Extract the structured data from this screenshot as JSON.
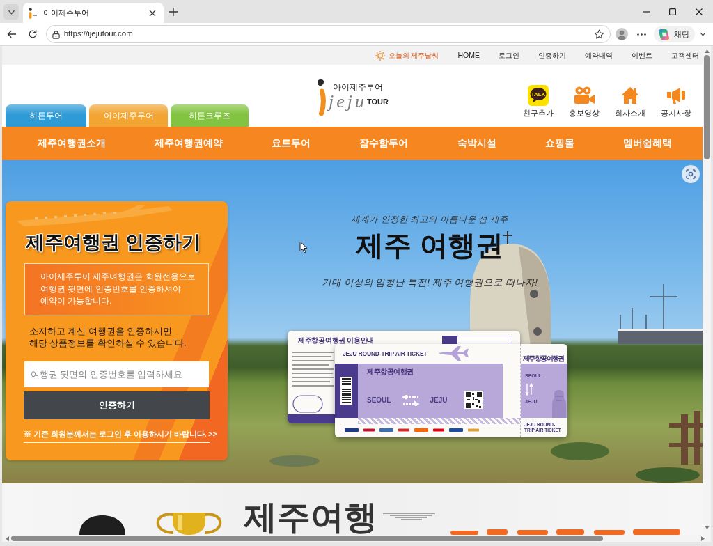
{
  "browser": {
    "tab_title": "아이제주투어",
    "url": "https://ijejutour.com",
    "chat_label": "채팅"
  },
  "top_links": [
    {
      "label": "오늘의 제주날씨",
      "kind": "weather"
    },
    {
      "label": "HOME",
      "kind": "link"
    },
    {
      "label": "로그인",
      "kind": "link"
    },
    {
      "label": "인증하기",
      "kind": "link"
    },
    {
      "label": "예약내역",
      "kind": "link"
    },
    {
      "label": "이벤트",
      "kind": "link"
    },
    {
      "label": "고객센터",
      "kind": "link"
    }
  ],
  "logo": {
    "caption": "아이제주투어",
    "wordmark": "jeju",
    "suffix": "TOUR"
  },
  "site_tabs": [
    {
      "label": "히든투어",
      "color": "#2e9ad6"
    },
    {
      "label": "아이제주투어",
      "color": "#f2a533"
    },
    {
      "label": "히든크루즈",
      "color": "#82c341"
    }
  ],
  "quick_links": [
    {
      "label": "친구추가",
      "kind": "talk",
      "icon_text": "TALK"
    },
    {
      "label": "홍보영상",
      "kind": "video"
    },
    {
      "label": "회사소개",
      "kind": "home"
    },
    {
      "label": "공지사항",
      "kind": "notice"
    }
  ],
  "main_nav": [
    "제주여행권소개",
    "제주여행권예약",
    "요트투어",
    "잠수함투어",
    "숙박시설",
    "쇼핑몰",
    "멤버쉽혜택"
  ],
  "voucher_card": {
    "title": "제주여행권 인증하기",
    "notice": "아이제주투어 제주여행권은 회원전용으로\n여행권 뒷면에 인증번호를 인증하셔야\n예약이 가능합니다.",
    "description": "소지하고 계신 여행권을 인증하시면\n해당 상품정보를 확인하실 수 있습니다.",
    "input": {
      "placeholder": "여행권 뒷면의 인증번호를 입력하세요"
    },
    "button": "인증하기",
    "member_link": "※ 기존 회원분께서는 로그인 후 이용하시기 바랍니다. >>"
  },
  "hero": {
    "kicker": "세계가 인정한 최고의 아름다운 섬 제주",
    "headline": "제주 여행권",
    "tagline": "기대 이상의 엄청난 특전! 제주 여행권으로 떠나자!"
  },
  "tickets": {
    "guide_title": "제주항공여행권 이용안내",
    "header": "JEJU ROUND-TRIP AIR TICKET",
    "name": "제주항공여행권",
    "from": "SEOUL",
    "to": "JEJU",
    "stub_name": "제주항공여행권",
    "stub_from": "SEOUL",
    "stub_to": "JEJU",
    "stub_footer": "JEJU ROUND-TRIP AIR TICKET"
  },
  "promo_banner": {
    "title": "제주여행"
  }
}
